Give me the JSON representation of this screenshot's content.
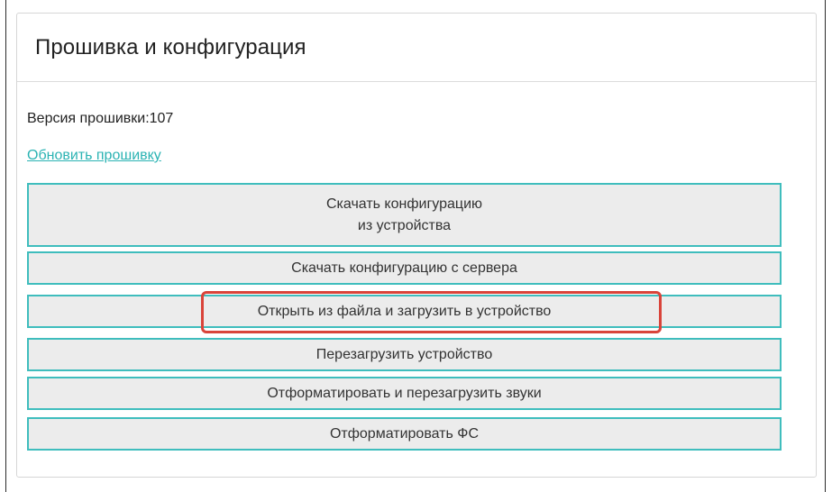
{
  "panel": {
    "title": "Прошивка и конфигурация"
  },
  "firmware": {
    "version_text": "Версия прошивки:107",
    "update_link": "Обновить прошивку"
  },
  "buttons": {
    "download_from_device_line1": "Скачать конфигурацию",
    "download_from_device_line2": "из устройства",
    "download_from_server": "Скачать конфигурацию с сервера",
    "open_and_upload": "Открыть из файла и загрузить в устройство",
    "reboot": "Перезагрузить устройство",
    "format_reload_sounds": "Отформатировать и перезагрузить звуки",
    "format_fs": "Отформатировать ФС"
  },
  "colors": {
    "accent": "#3fbdbd",
    "link": "#2bb3b3",
    "button_bg": "#ececec",
    "highlight": "#d9443a"
  }
}
